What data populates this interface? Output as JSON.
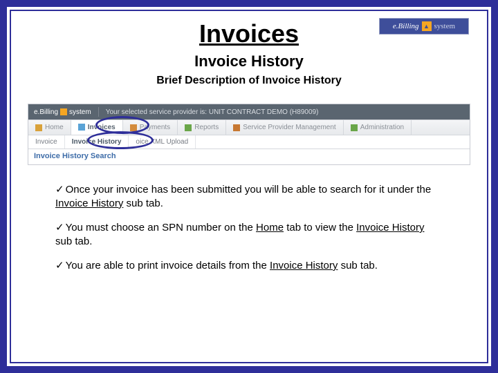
{
  "brand": {
    "e": "e.Billing",
    "sys": "system",
    "star": "▲"
  },
  "title": "Invoices",
  "subtitle": "Invoice History",
  "description": "Brief Description of Invoice History",
  "app": {
    "topbar_brand_e": "e.Billing",
    "topbar_brand_sys": "system",
    "provider_text": "Your selected service provider is: UNIT CONTRACT DEMO (H89009)",
    "tabs": {
      "home": "Home",
      "invoices": "Invoices",
      "payments": "Payments",
      "reports": "Reports",
      "spm": "Service Provider Management",
      "admin": "Administration"
    },
    "subtabs": {
      "invoice": "Invoice",
      "invoice_history": "Invoice History",
      "xml_upload": "oice XML Upload"
    },
    "search_header": "Invoice History Search"
  },
  "bullets": {
    "check": "✓",
    "b1a": "Once your invoice has been submitted you will be able to search for it under the ",
    "b1u": "Invoice History",
    "b1b": " sub tab.",
    "b2a": "You must choose an SPN number on the ",
    "b2u1": "Home",
    "b2mid": " tab to view the ",
    "b2u2": "Invoice History",
    "b2b": " sub tab.",
    "b3a": "You are able to print invoice details from the ",
    "b3u": "Invoice History",
    "b3b": " sub tab."
  }
}
